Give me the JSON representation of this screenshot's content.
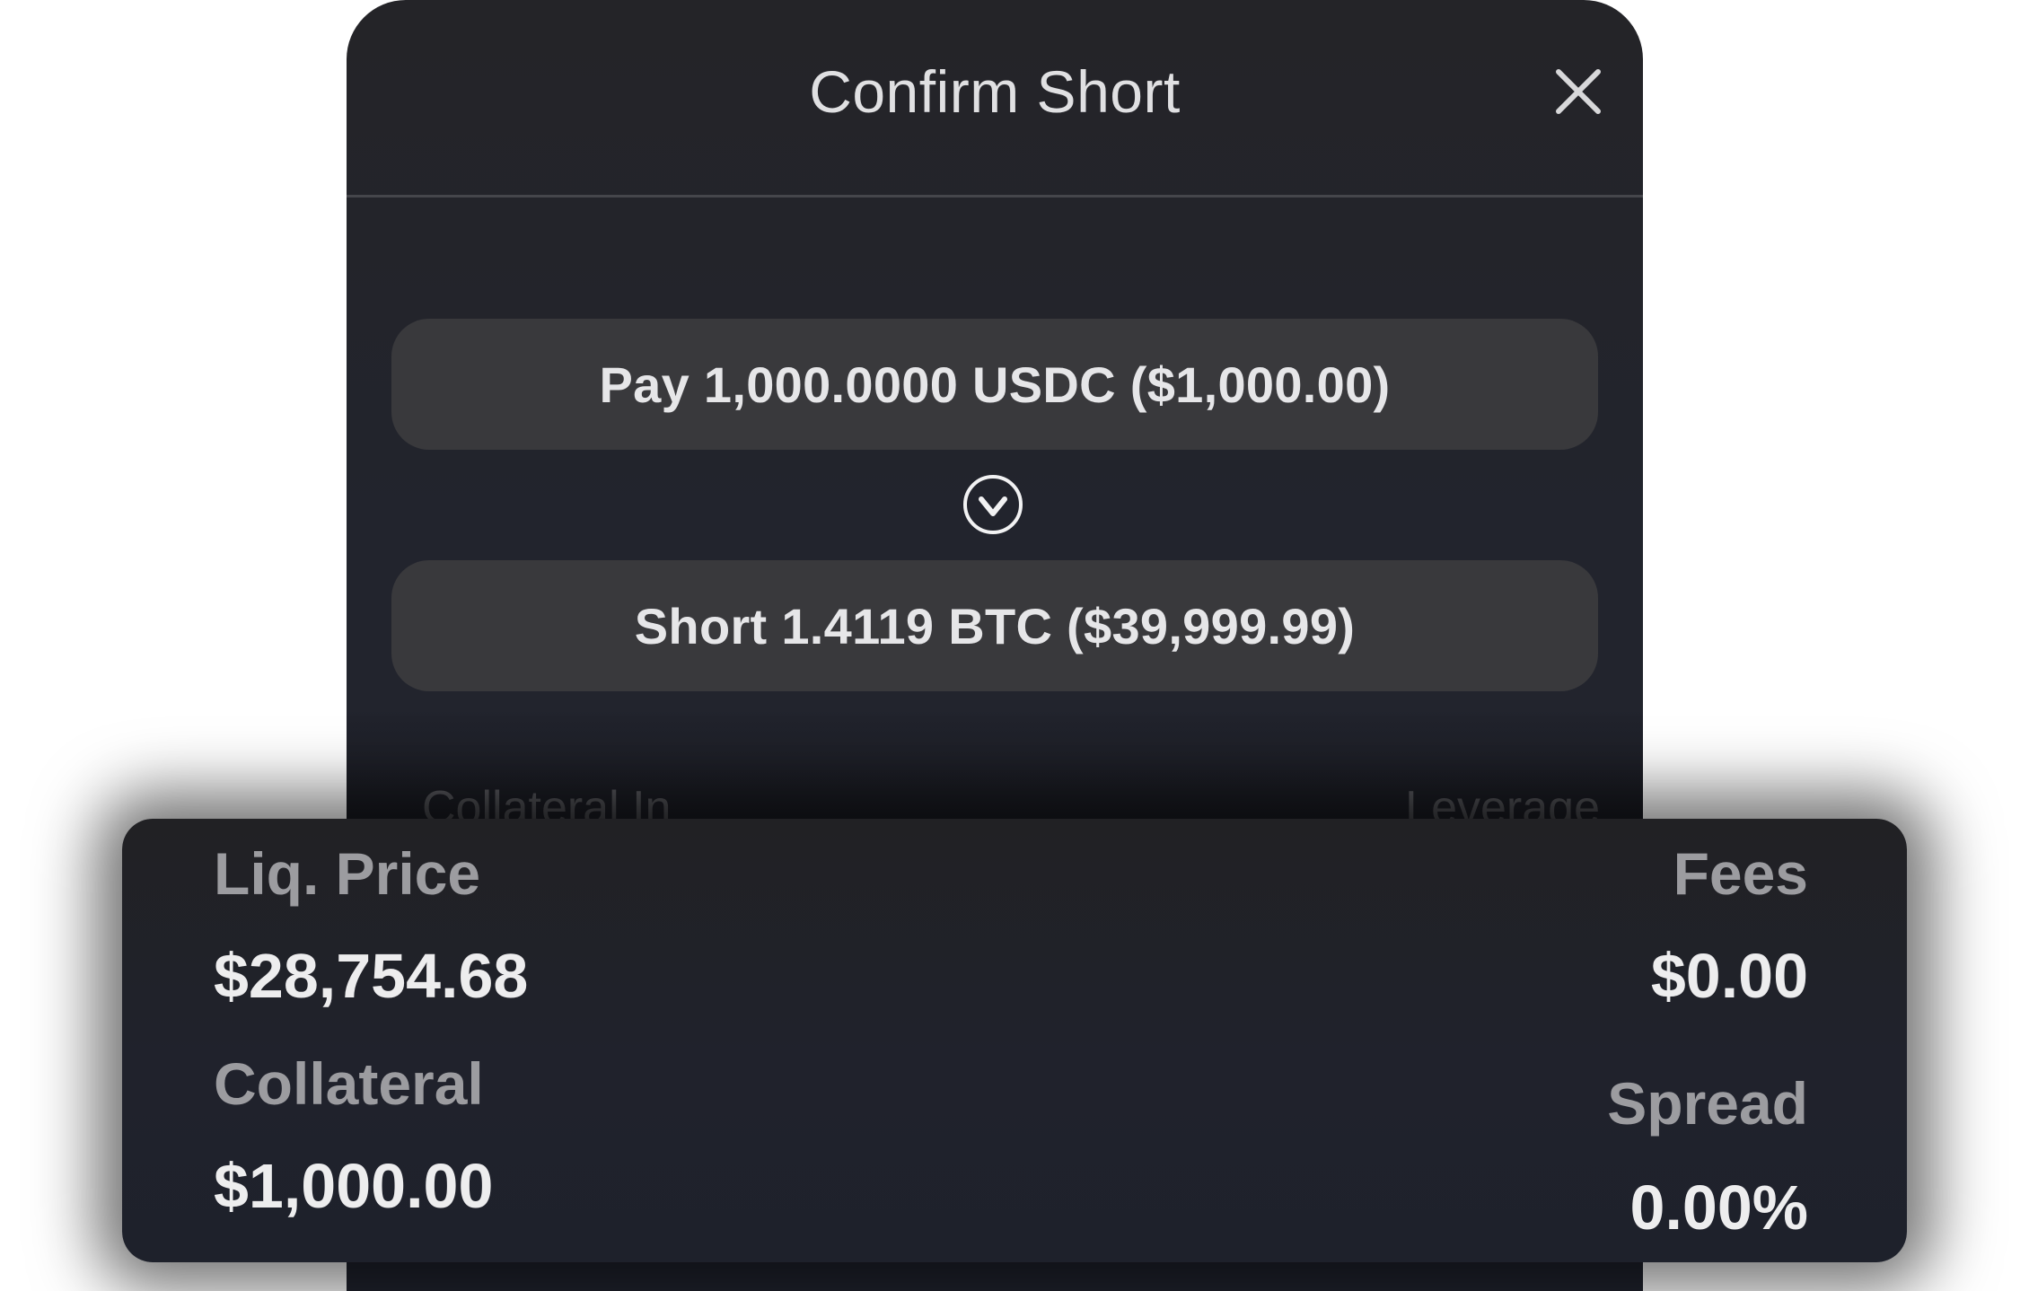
{
  "modal": {
    "title": "Confirm Short",
    "close_icon": "close-icon",
    "pay_summary": "Pay 1,000.0000 USDC ($1,000.00)",
    "arrow_icon": "chevron-down-circle-icon",
    "short_summary": "Short 1.4119 BTC ($39,999.99)",
    "collateral_in_label": "Collateral In",
    "leverage_label": "Leverage"
  },
  "details": {
    "liq_price_label": "Liq. Price",
    "liq_price_value": "$28,754.68",
    "collateral_label": "Collateral",
    "collateral_value": "$1,000.00",
    "fees_label": "Fees",
    "fees_value": "$0.00",
    "spread_label": "Spread",
    "spread_value": "0.00%"
  },
  "colors": {
    "modal_bg": "#242428",
    "box_bg": "#39393c",
    "label_text": "#9c9ca0",
    "value_text": "#ededee"
  }
}
